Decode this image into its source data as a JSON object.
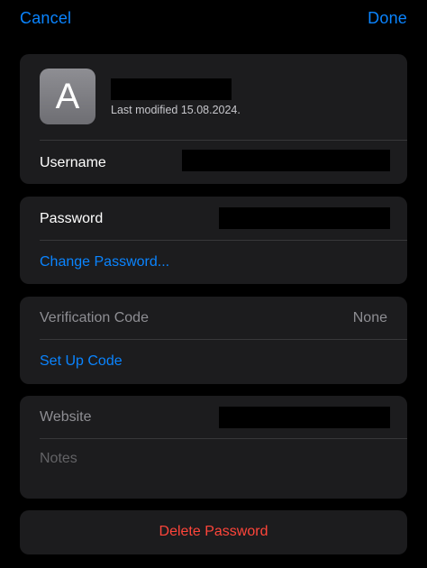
{
  "nav": {
    "cancel_label": "Cancel",
    "done_label": "Done"
  },
  "header_card": {
    "avatar_letter": "A",
    "last_modified": "Last modified 15.08.2024.",
    "username_label": "Username"
  },
  "password_card": {
    "password_label": "Password",
    "change_password_label": "Change Password..."
  },
  "verification_card": {
    "verification_label": "Verification Code",
    "verification_value": "None",
    "setup_label": "Set Up Code"
  },
  "website_card": {
    "website_label": "Website",
    "notes_placeholder": "Notes"
  },
  "delete_label": "Delete Password",
  "colors": {
    "accent": "#0a84ff",
    "destructive": "#ff453a",
    "card_background": "#1c1c1e"
  }
}
